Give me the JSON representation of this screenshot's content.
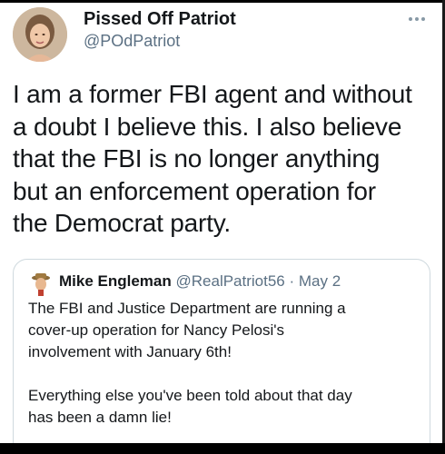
{
  "tweet": {
    "author": {
      "display_name": "Pissed Off Patriot",
      "handle": "@POdPatriot",
      "avatar_icon": "profile-photo"
    },
    "more_icon": "ellipsis-icon",
    "text_lines": [
      "I am a former FBI agent and without",
      "a doubt I believe this. I also believe",
      "that the FBI is no longer anything",
      "but an enforcement operation for",
      "the Democrat party."
    ]
  },
  "quoted_tweet": {
    "author": {
      "display_name": "Mike Engleman",
      "handle": "@RealPatriot56",
      "separator": " · ",
      "date": "May 2",
      "avatar_icon": "profile-photo"
    },
    "text_lines": [
      "The FBI and Justice Department are running a",
      "cover-up operation for Nancy Pelosi's",
      "involvement with January 6th!",
      "",
      "Everything else you've been told about that day",
      "has been a damn lie!"
    ]
  },
  "colors": {
    "text_primary": "#14171a",
    "text_secondary": "#5b7083",
    "border": "#cfd9de",
    "background": "#ffffff"
  }
}
